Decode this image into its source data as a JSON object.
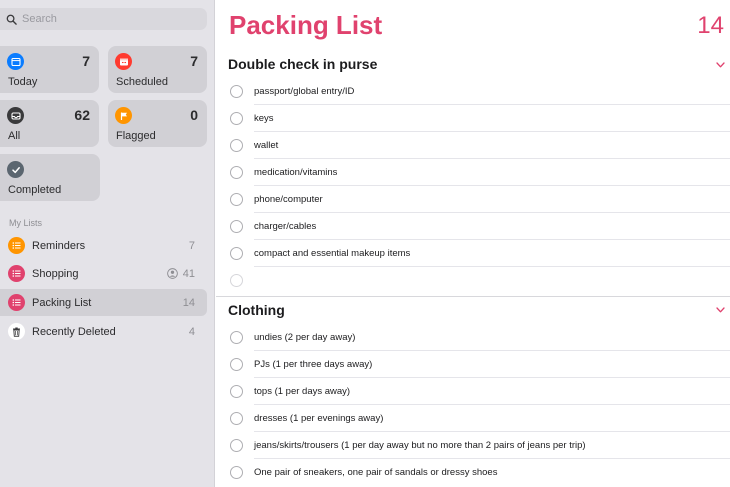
{
  "search": {
    "placeholder": "Search"
  },
  "smart_lists": [
    {
      "label": "Today",
      "count": "7",
      "icon": "calendar-icon",
      "color": "#0a7cff"
    },
    {
      "label": "Scheduled",
      "count": "7",
      "icon": "calendar-clock-icon",
      "color": "#ff3b30"
    },
    {
      "label": "All",
      "count": "62",
      "icon": "tray-icon",
      "color": "#3a3a3c"
    },
    {
      "label": "Flagged",
      "count": "0",
      "icon": "flag-icon",
      "color": "#ff9500"
    },
    {
      "label": "Completed",
      "count": "",
      "icon": "checkmark-icon",
      "color": "#5b6670"
    }
  ],
  "my_lists": {
    "label": "My Lists",
    "items": [
      {
        "name": "Reminders",
        "count": "7",
        "color": "#ff9500",
        "icon": "list-icon"
      },
      {
        "name": "Shopping",
        "count": "41",
        "color": "#e0426e",
        "icon": "list-icon",
        "shared": true
      },
      {
        "name": "Packing List",
        "count": "14",
        "color": "#e0426e",
        "icon": "list-icon",
        "selected": true
      },
      {
        "name": "Recently Deleted",
        "count": "4",
        "color": "#ffffff",
        "icon": "trash-icon"
      }
    ]
  },
  "main": {
    "title": "Packing List",
    "count": "14",
    "accent": "#e0426e",
    "sections": [
      {
        "title": "Double check in purse",
        "items": [
          "passport/global entry/ID",
          "keys",
          "wallet",
          "medication/vitamins",
          "phone/computer",
          "charger/cables",
          "compact and essential makeup items"
        ]
      },
      {
        "title": "Clothing",
        "items": [
          "undies (2 per day away)",
          "PJs (1 per three days away)",
          "tops (1 per days away)",
          "dresses (1 per evenings away)",
          "jeans/skirts/trousers (1 per day away but no more than 2 pairs of jeans per trip)",
          "One pair of sneakers, one pair of sandals or dressy shoes"
        ]
      }
    ]
  }
}
